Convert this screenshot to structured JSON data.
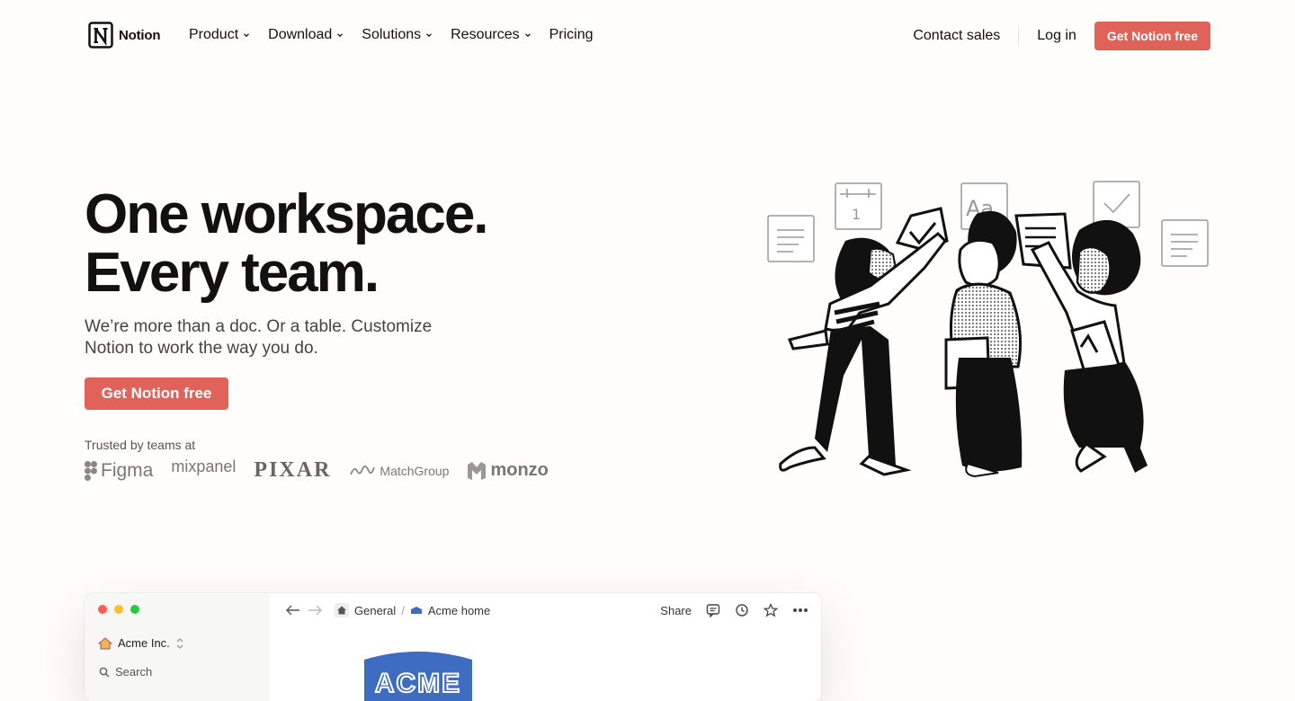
{
  "nav": {
    "brand": "Notion",
    "links": [
      {
        "label": "Product",
        "dropdown": true
      },
      {
        "label": "Download",
        "dropdown": true
      },
      {
        "label": "Solutions",
        "dropdown": true
      },
      {
        "label": "Resources",
        "dropdown": true
      },
      {
        "label": "Pricing",
        "dropdown": false
      }
    ],
    "contact_sales": "Contact sales",
    "log_in": "Log in",
    "cta": "Get Notion free"
  },
  "hero": {
    "title_line1": "One workspace.",
    "title_line2": "Every team.",
    "subtitle": "We’re more than a doc. Or a table. Customize Notion to work the way you do.",
    "cta": "Get Notion free",
    "trusted_label": "Trusted by teams at",
    "logos": [
      "Figma",
      "mixpanel",
      "PIXAR",
      "MatchGroup",
      "monzo"
    ]
  },
  "preview": {
    "workspace_name": "Acme Inc.",
    "search_label": "Search",
    "breadcrumb": [
      "General",
      "Acme home"
    ],
    "breadcrumb_separator": "/",
    "share_label": "Share",
    "logo_text": "ACME"
  },
  "colors": {
    "accent": "#e16259",
    "background": "#fffefc",
    "text": "#111111"
  },
  "icons": [
    "notion-logo-icon",
    "chevron-down-icon",
    "figma-icon",
    "match-icon",
    "monzo-icon",
    "back-arrow-icon",
    "forward-arrow-icon",
    "home-icon",
    "comment-icon",
    "clock-icon",
    "star-icon",
    "more-icon",
    "search-icon"
  ]
}
